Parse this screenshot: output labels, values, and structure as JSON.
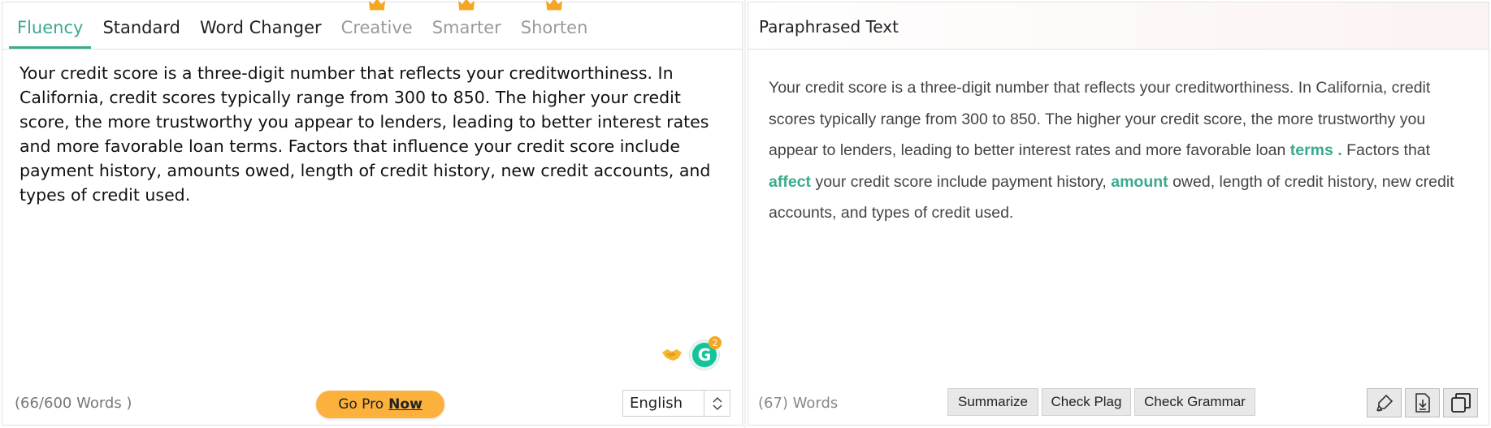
{
  "left": {
    "tabs": [
      {
        "label": "Fluency",
        "active": true,
        "premium": false
      },
      {
        "label": "Standard",
        "active": false,
        "premium": false
      },
      {
        "label": "Word Changer",
        "active": false,
        "premium": false
      },
      {
        "label": "Creative",
        "active": false,
        "premium": true
      },
      {
        "label": "Smarter",
        "active": false,
        "premium": true
      },
      {
        "label": "Shorten",
        "active": false,
        "premium": true
      }
    ],
    "input_text": "Your credit score is a three-digit number that reflects your creditworthiness. In California, credit scores typically range from 300 to 850. The higher your credit score, the more trustworthy you appear to lenders, leading to better interest rates and more favorable loan terms. Factors that influence your credit score include payment history, amounts owed, length of credit history, new credit accounts, and types of credit used.",
    "grammarly_count": "2",
    "grammarly_letter": "G",
    "word_count": "(66/600 Words )",
    "go_pro": {
      "text": "Go Pro",
      "now": "Now"
    },
    "language": "English"
  },
  "right": {
    "title": "Paraphrased Text",
    "output_segments": [
      {
        "text": "Your credit score is a three-digit number that reflects your creditworthiness. In California, credit scores typically range from 300 to 850. The higher your credit score, the more trustworthy you appear to lenders, leading to better interest rates and more favorable loan ",
        "changed": false
      },
      {
        "text": "terms .",
        "changed": true
      },
      {
        "text": " Factors that ",
        "changed": false
      },
      {
        "text": "affect",
        "changed": true
      },
      {
        "text": " your credit score include payment history, ",
        "changed": false
      },
      {
        "text": "amount",
        "changed": true
      },
      {
        "text": " owed, length of credit history, new credit accounts, and types of credit used.",
        "changed": false
      }
    ],
    "word_count": "(67) Words",
    "buttons": {
      "summarize": "Summarize",
      "check_plag": "Check Plag",
      "check_grammar": "Check Grammar"
    },
    "icons": [
      "highlighter-icon",
      "download-icon",
      "copy-icon"
    ]
  },
  "colors": {
    "accent": "#3aaa8f",
    "premium_text": "#9a9a9a",
    "go_pro_bg": "#fbb13c",
    "crown": "#f5a623"
  }
}
